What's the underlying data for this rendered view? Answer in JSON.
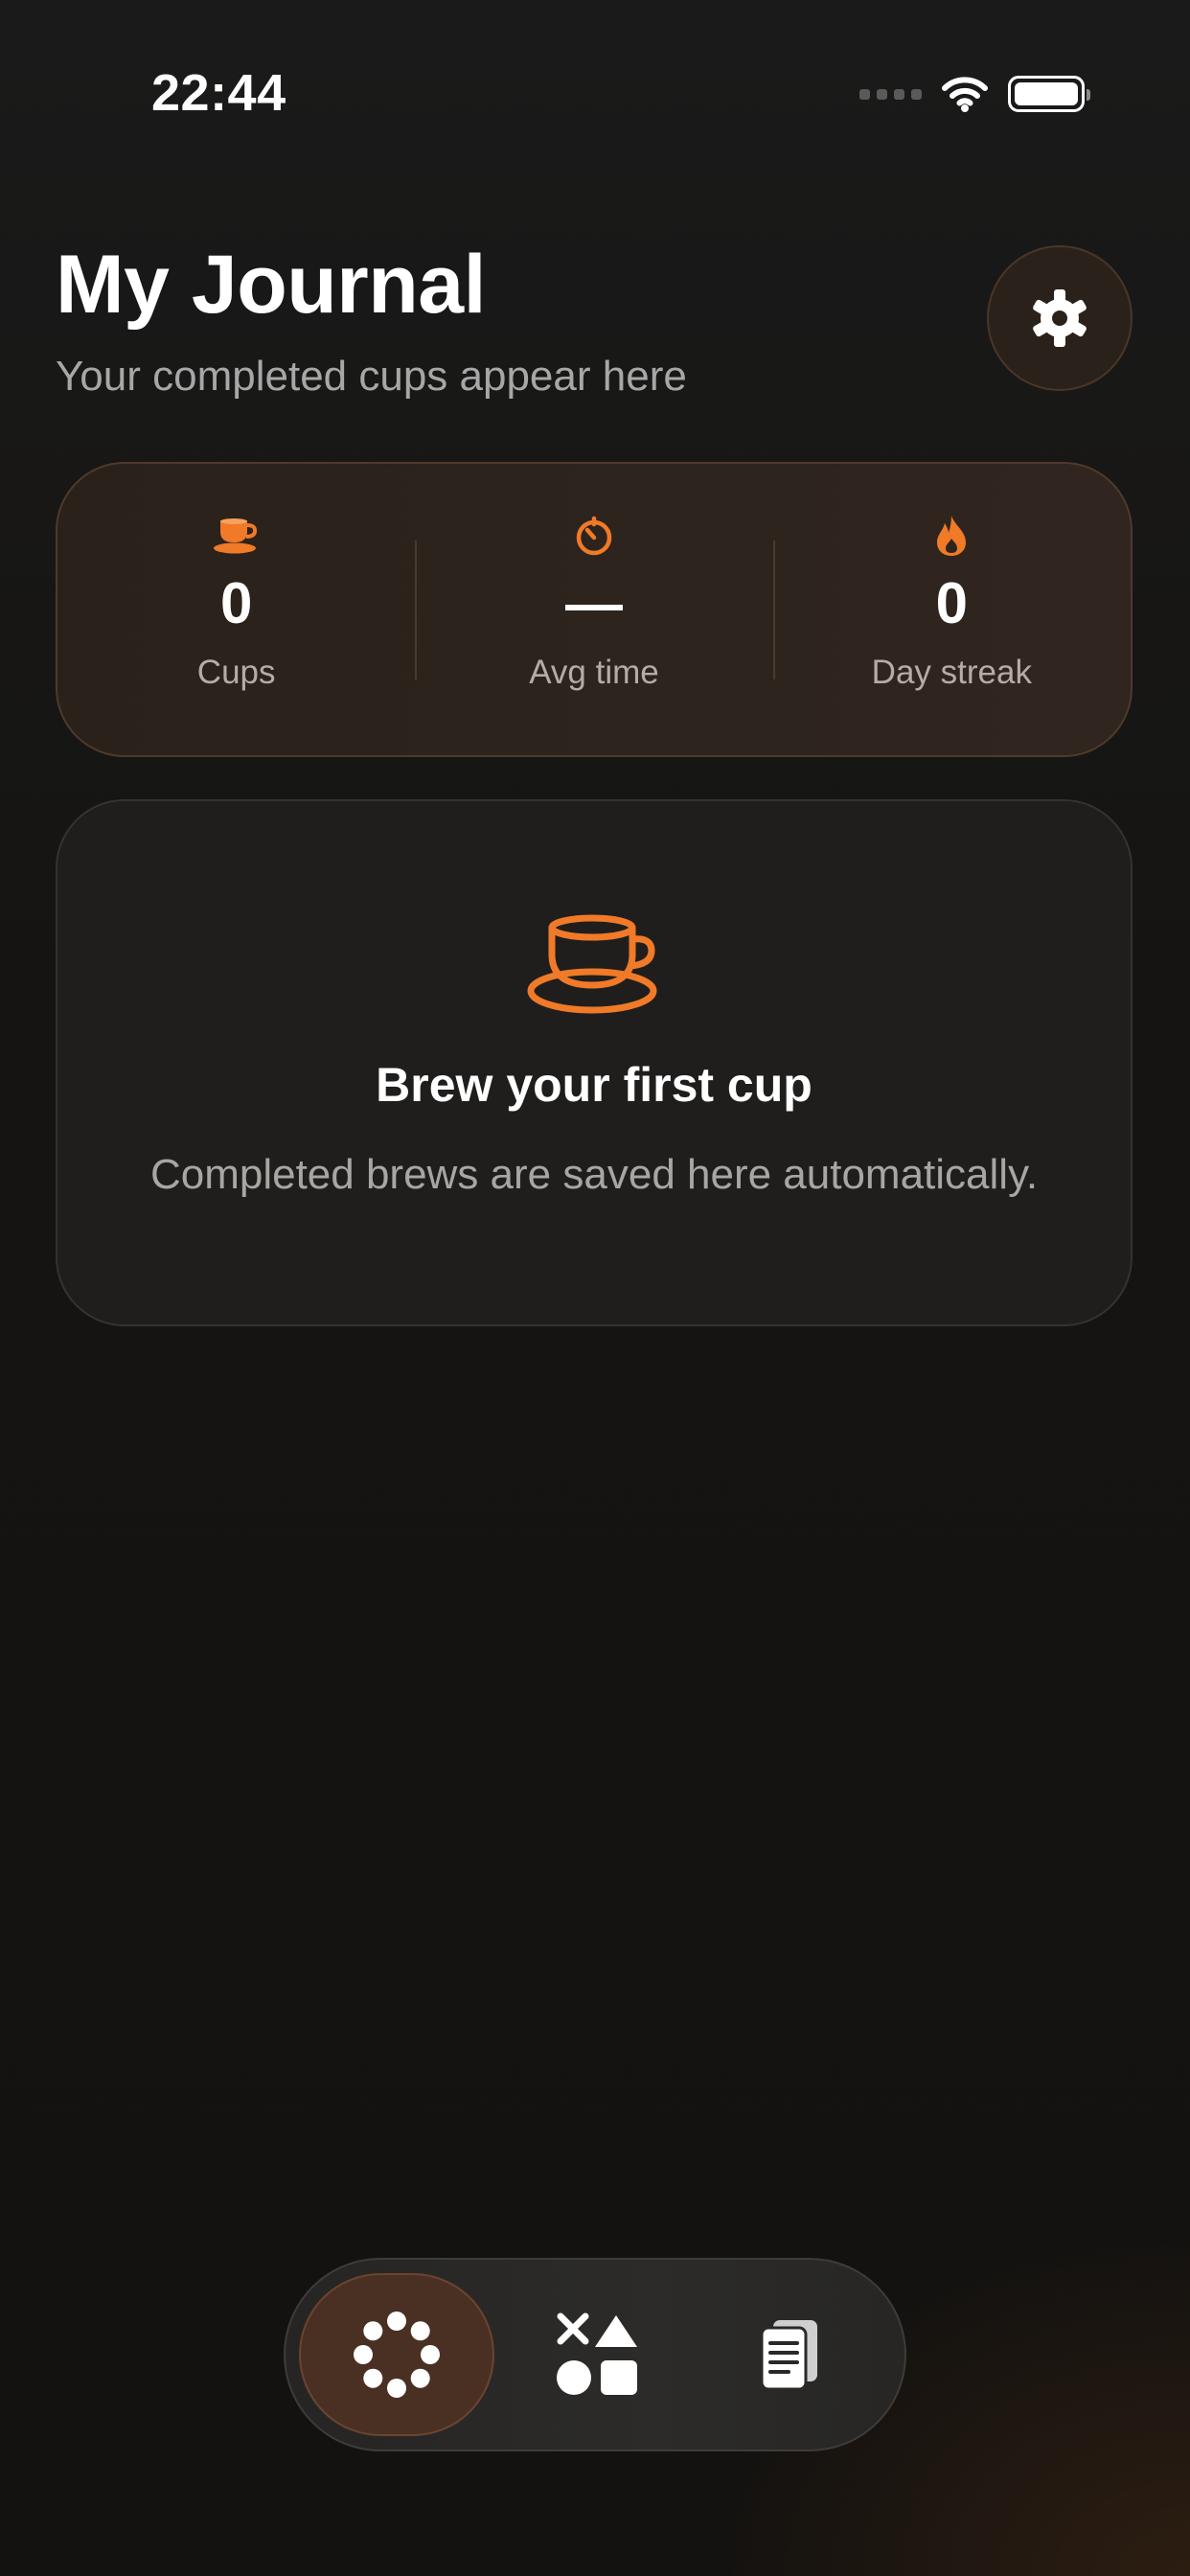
{
  "status_bar": {
    "time": "22:44"
  },
  "header": {
    "title": "My Journal",
    "subtitle": "Your completed cups appear here",
    "settings_icon": "gear-icon"
  },
  "stats": [
    {
      "icon": "coffee-cup-icon",
      "value": "0",
      "label": "Cups"
    },
    {
      "icon": "timer-icon",
      "value": "—",
      "label": "Avg time"
    },
    {
      "icon": "flame-icon",
      "value": "0",
      "label": "Day streak"
    }
  ],
  "empty_state": {
    "icon": "coffee-cup-icon",
    "title": "Brew your first cup",
    "text": "Completed brews are saved here automatically."
  },
  "tab_bar": {
    "tabs": [
      {
        "icon": "dots-ring-icon",
        "selected": true
      },
      {
        "icon": "shapes-icon",
        "selected": false
      },
      {
        "icon": "journal-pages-icon",
        "selected": false
      }
    ]
  },
  "colors": {
    "accent": "#F07A28",
    "background": "#141312",
    "card": "#1F1E1D",
    "stats_card": "#2E241E",
    "subtitle": "#A7A7A7"
  }
}
